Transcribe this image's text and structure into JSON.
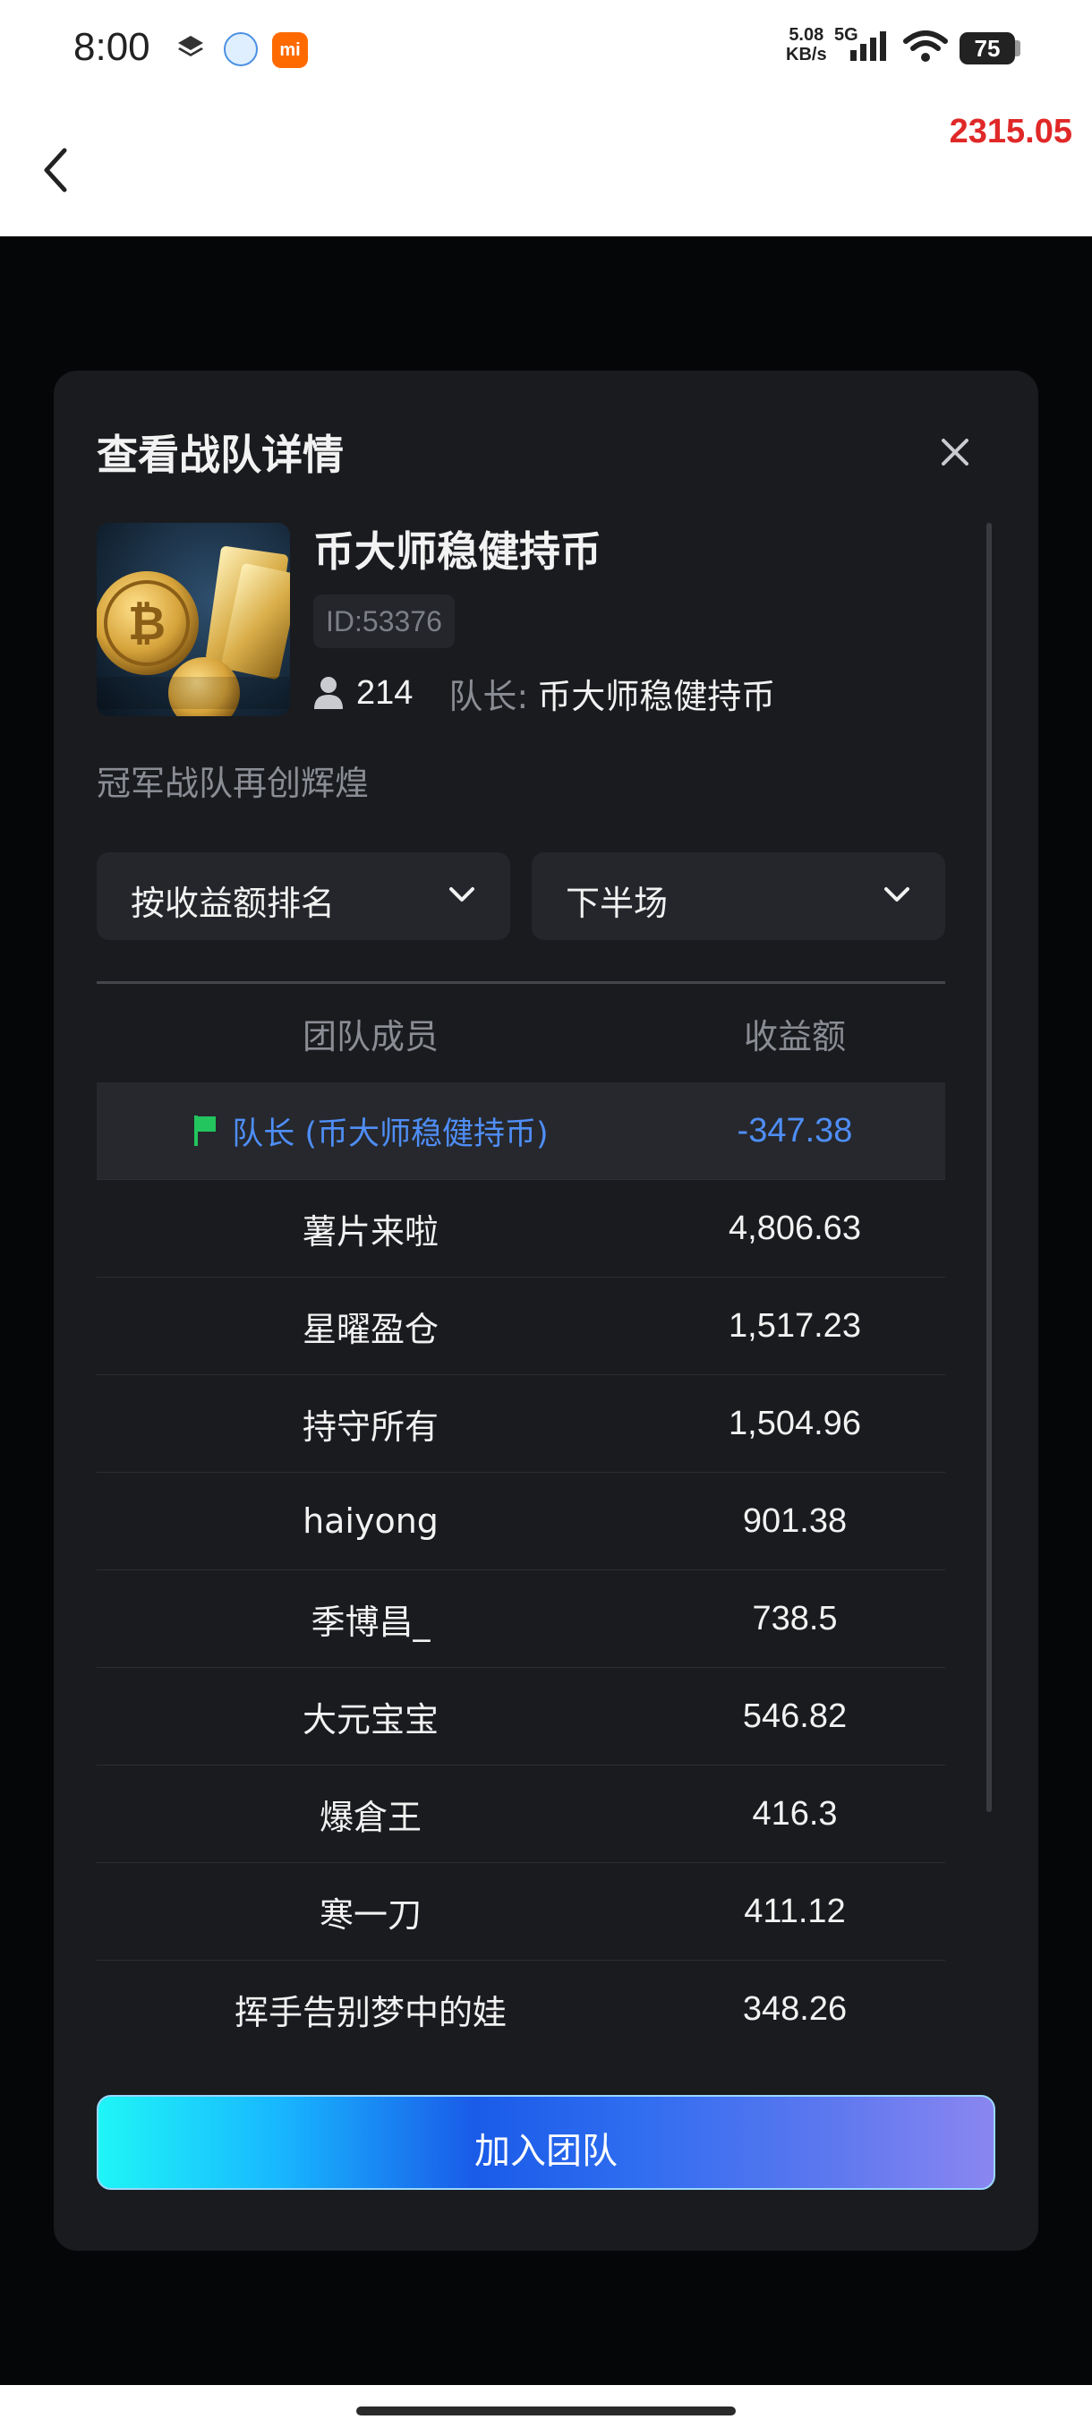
{
  "status_bar": {
    "time": "8:00",
    "net_speed_value": "5.08",
    "net_speed_unit": "KB/s",
    "network_type": "5G",
    "battery": "75",
    "icons": [
      "layers-icon",
      "browser-app-icon",
      "mi-app-icon",
      "signal-icon",
      "wifi-icon",
      "battery-icon"
    ]
  },
  "header": {
    "value": "2315.05",
    "value_color": "#e02828"
  },
  "modal": {
    "title": "查看战队详情",
    "team": {
      "name": "币大师稳健持币",
      "id": "ID:53376",
      "member_count": "214",
      "captain_label": "队长:",
      "captain_name": "币大师稳健持币",
      "slogan": "冠军战队再创辉煌"
    },
    "filters": {
      "sort": "按收益额排名",
      "period": "下半场"
    },
    "table": {
      "headers": [
        "团队成员",
        "收益额"
      ],
      "captain_row": {
        "name": "队长 (币大师稳健持币)",
        "value": "-347.38"
      },
      "rows": [
        {
          "name": "薯片来啦",
          "value": "4,806.63"
        },
        {
          "name": "星曜盈仓",
          "value": "1,517.23"
        },
        {
          "name": "持守所有",
          "value": "1,504.96"
        },
        {
          "name": "haiyong",
          "value": "901.38"
        },
        {
          "name": "季博昌_",
          "value": "738.5"
        },
        {
          "name": "大元宝宝",
          "value": "546.82"
        },
        {
          "name": "爆倉王",
          "value": "416.3"
        },
        {
          "name": "寒一刀",
          "value": "411.12"
        },
        {
          "name": "挥手告别梦中的娃",
          "value": "348.26"
        }
      ]
    },
    "join_button": "加入团队"
  },
  "colors": {
    "accent_blue": "#4f8ef7",
    "flag_green": "#22c55e",
    "modal_bg": "#1a1b1f"
  }
}
